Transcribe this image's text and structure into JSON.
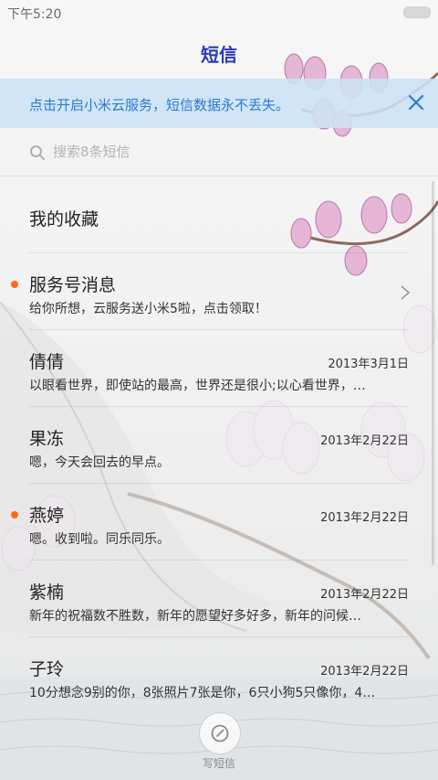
{
  "status_bar": {
    "time": "下午5:20"
  },
  "header": {
    "title": "短信"
  },
  "cloud_banner": {
    "text": "点击开启小米云服务，短信数据永不丢失。"
  },
  "search": {
    "placeholder": "搜索8条短信"
  },
  "favorites": {
    "label": "我的收藏"
  },
  "conversations": [
    {
      "name": "服务号消息",
      "preview": "给你所想，云服务送小米5啦，点击领取！",
      "date": "",
      "unread": true
    },
    {
      "name": "倩倩",
      "preview": "以眼看世界，即使站的最高，世界还是很小;以心看世界，…",
      "date": "2013年3月1日",
      "unread": false
    },
    {
      "name": "果冻",
      "preview": "嗯，今天会回去的早点。",
      "date": "2013年2月22日",
      "unread": false
    },
    {
      "name": "燕婷",
      "preview": "嗯。收到啦。同乐同乐。",
      "date": "2013年2月22日",
      "unread": true
    },
    {
      "name": "紫楠",
      "preview": "新年的祝福数不胜数，新年的愿望好多好多，新年的问候…",
      "date": "2013年2月22日",
      "unread": false
    },
    {
      "name": "子玲",
      "preview": "10分想念9别的你，8张照片7张是你，6只小狗5只像你，4…",
      "date": "2013年2月22日",
      "unread": false
    }
  ],
  "compose": {
    "label": "写短信"
  },
  "colors": {
    "title": "#2a3bb8",
    "banner_text": "#2a7bd1",
    "unread_dot": "#ff6a1a",
    "banner_bg": "#cde2f6"
  }
}
